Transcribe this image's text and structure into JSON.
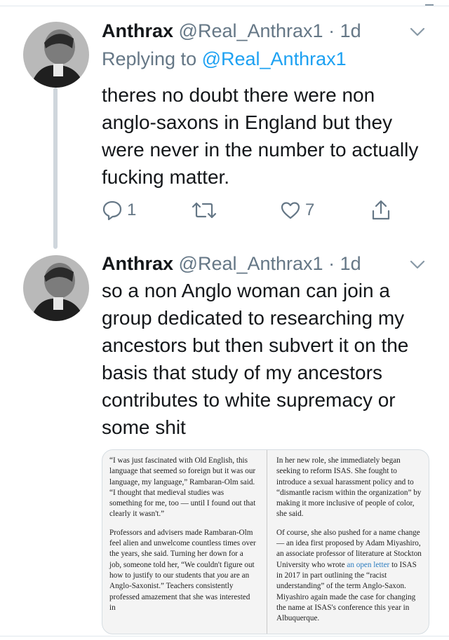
{
  "tweets": [
    {
      "name": "Anthrax",
      "handle": "@Real_Anthrax1",
      "separator": "·",
      "time": "1d",
      "reply_prefix": "Replying to ",
      "reply_mention": "@Real_Anthrax1",
      "text": "theres no doubt there were non anglo-saxons in England but they were never in the number to actually fucking matter.",
      "reply_count": "1",
      "like_count": "7"
    },
    {
      "name": "Anthrax",
      "handle": "@Real_Anthrax1",
      "separator": "·",
      "time": "1d",
      "text": "so a non Anglo woman can join a group dedicated to researching my ancestors but then subvert it on the basis that study of my ancestors contributes to white supremacy or some shit"
    }
  ],
  "article": {
    "left_p1": "“I was just fascinated with Old English, this language that seemed so foreign but it was our language, my language,” Rambaran-Olm said. “I thought that medieval studies was something for me, too — until I found out that clearly it wasn't.”",
    "left_p2_a": "Professors and advisers made Rambaran-Olm feel alien and unwelcome countless times over the years, she said. Turning her down for a job, someone told her, “We couldn't figure out how to justify to our students that ",
    "left_p2_em": "you",
    "left_p2_b": " are an Anglo-Saxonist.” Teachers consistently professed amazement that she was interested in",
    "right_p1": "In her new role, she immediately began seeking to reform ISAS. She fought to introduce a sexual harassment policy and to “dismantle racism within the organization” by making it more inclusive of people of color, she said.",
    "right_p2_a": "Of course, she also pushed for a name change — an idea first proposed by Adam Miyashiro, an associate professor of literature at Stockton University who wrote ",
    "right_p2_link": "an open letter",
    "right_p2_b": " to ISAS in 2017 in part outlining the “racist understanding” of the term Anglo-Saxon. Miyashiro again made the case for changing the name at ISAS's conference this year in Albuquerque."
  },
  "icons": [
    "avatar",
    "chevron-down-icon",
    "reply-icon",
    "retweet-icon",
    "like-icon",
    "share-icon"
  ],
  "colors": {
    "text": "#14171a",
    "secondary": "#657786",
    "link": "#1da1f2",
    "thread_line": "#cfd6dc"
  }
}
